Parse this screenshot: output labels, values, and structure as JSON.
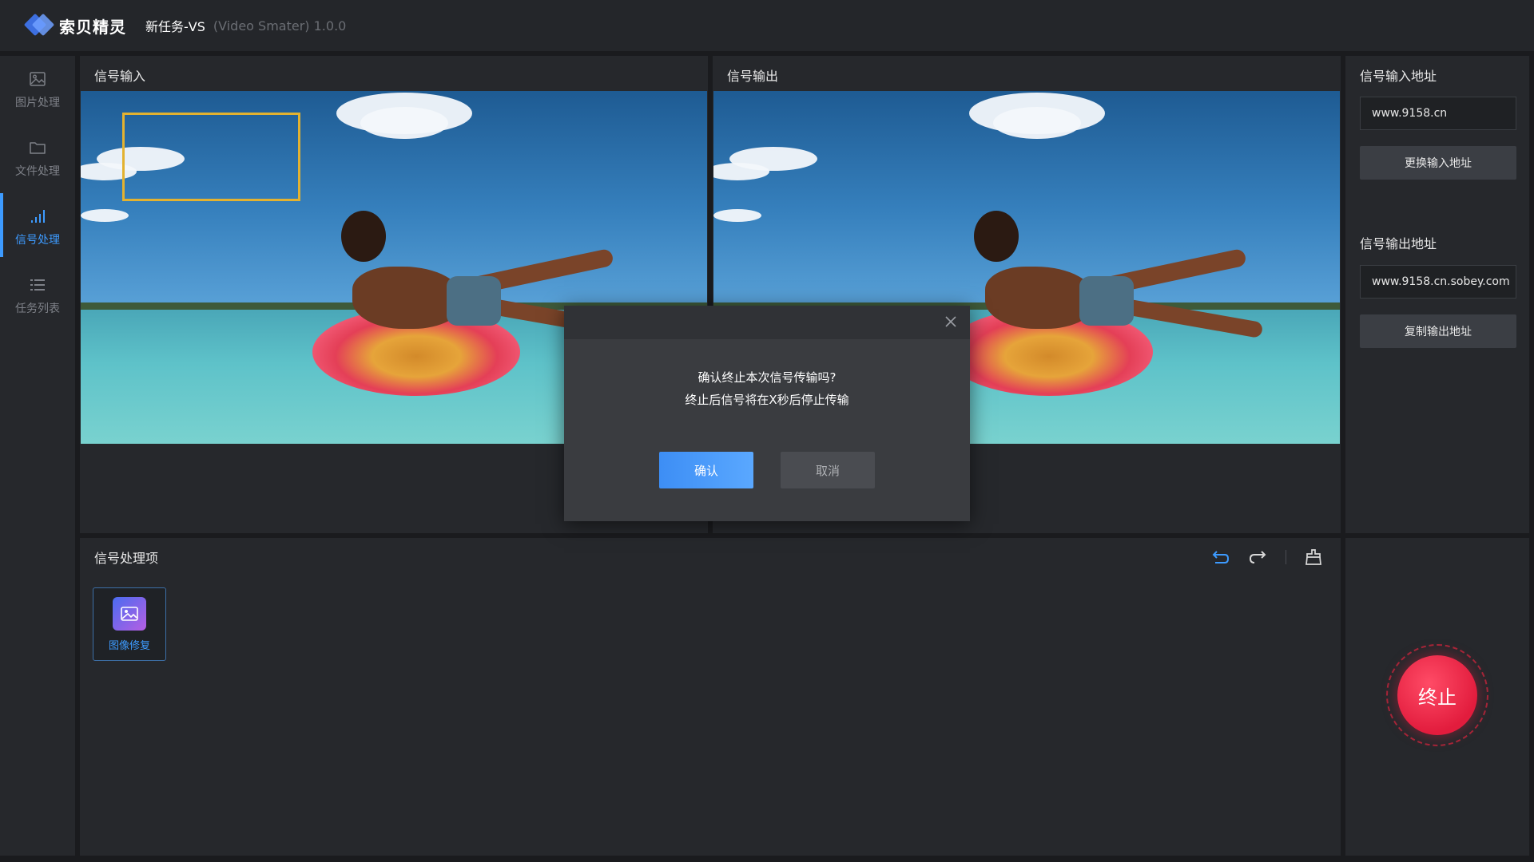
{
  "header": {
    "logo_text": "索贝精灵",
    "task_name": "新任务-VS",
    "app_subtitle": "(Video Smater) 1.0.0"
  },
  "sidebar": {
    "items": [
      {
        "label": "图片处理",
        "icon": "image-icon"
      },
      {
        "label": "文件处理",
        "icon": "folder-icon"
      },
      {
        "label": "信号处理",
        "icon": "signal-icon",
        "active": true
      },
      {
        "label": "任务列表",
        "icon": "list-icon"
      }
    ]
  },
  "input_panel": {
    "title": "信号输入"
  },
  "output_panel": {
    "title": "信号输出"
  },
  "right_panel": {
    "input_addr_title": "信号输入地址",
    "input_addr_value": "www.9158.cn",
    "change_input_btn": "更换输入地址",
    "output_addr_title": "信号输出地址",
    "output_addr_value": "www.9158.cn.sobey.com",
    "copy_output_btn": "复制输出地址"
  },
  "processing": {
    "title": "信号处理项",
    "items": [
      {
        "label": "图像修复",
        "icon": "image-repair-icon"
      }
    ],
    "toolbar": [
      "undo-icon",
      "redo-icon",
      "clear-icon"
    ]
  },
  "stop_button": {
    "label": "终止",
    "color": "#e21c3d"
  },
  "modal": {
    "line1": "确认终止本次信号传输吗?",
    "line2": "终止后信号将在X秒后停止传输",
    "confirm_label": "确认",
    "cancel_label": "取消"
  },
  "colors": {
    "accent": "#3d9bff",
    "selection_box": "#e3b230",
    "danger": "#e21c3d"
  }
}
